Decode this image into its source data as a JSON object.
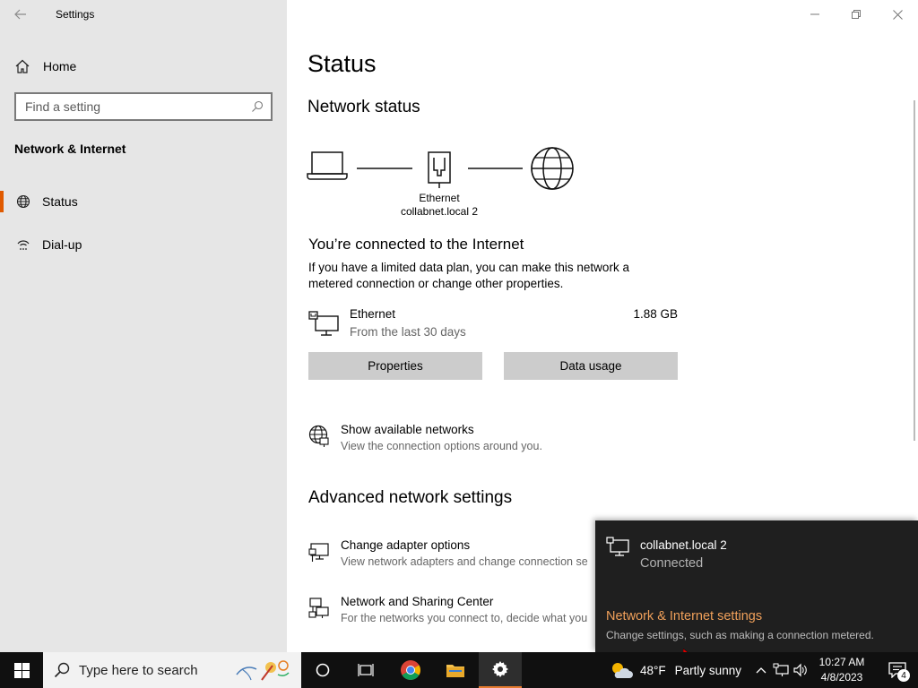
{
  "window": {
    "title": "Settings"
  },
  "sidebar": {
    "home_label": "Home",
    "search_placeholder": "Find a setting",
    "section_title": "Network & Internet",
    "items": [
      {
        "label": "Status",
        "icon": "globe-icon",
        "active": true
      },
      {
        "label": "Dial-up",
        "icon": "dialup-icon",
        "active": false
      }
    ]
  },
  "main": {
    "title": "Status",
    "network_status_heading": "Network status",
    "diagram": {
      "line1": "Ethernet",
      "line2": "collabnet.local 2"
    },
    "connected_heading": "You’re connected to the Internet",
    "connected_text": "If you have a limited data plan, you can make this network a metered connection or change other properties.",
    "ethernet": {
      "name": "Ethernet",
      "period": "From the last 30 days",
      "usage": "1.88 GB"
    },
    "buttons": {
      "properties": "Properties",
      "data_usage": "Data usage"
    },
    "show_networks": {
      "title": "Show available networks",
      "subtitle": "View the connection options around you."
    },
    "advanced_heading": "Advanced network settings",
    "change_adapter": {
      "title": "Change adapter options",
      "subtitle": "View network adapters and change connection se"
    },
    "sharing_center": {
      "title": "Network and Sharing Center",
      "subtitle": "For the networks you connect to, decide what you"
    }
  },
  "flyout": {
    "network_name": "collabnet.local 2",
    "status": "Connected",
    "settings_link": "Network & Internet settings",
    "settings_sub": "Change settings, such as making a connection metered."
  },
  "taskbar": {
    "search_placeholder": "Type here to search",
    "weather_temp": "48°F",
    "weather_text": "Partly sunny",
    "time": "10:27 AM",
    "date": "4/8/2023",
    "notification_count": "4",
    "accent": "#e57a2e"
  }
}
